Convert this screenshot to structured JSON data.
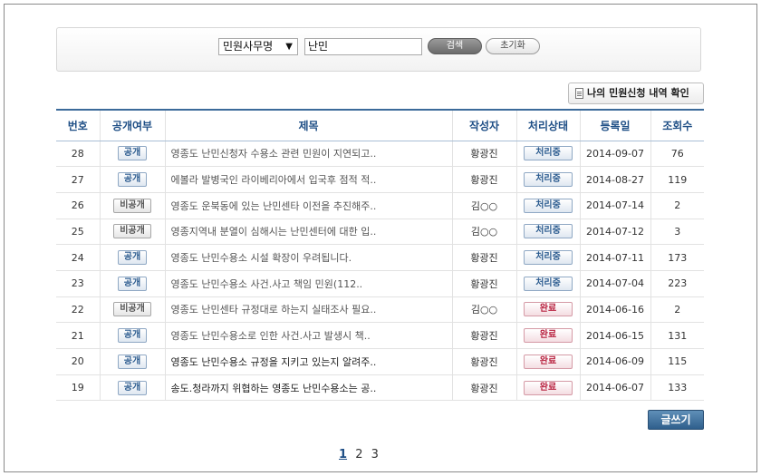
{
  "search": {
    "field_selected": "민원사무명",
    "keyword_value": "난민",
    "search_label": "검색",
    "reset_label": "초기화"
  },
  "my_requests_label": "나의 민원신청 내역 확인",
  "table": {
    "headers": [
      "번호",
      "공개여부",
      "제목",
      "작성자",
      "처리상태",
      "등록일",
      "조회수"
    ],
    "rows": [
      {
        "no": "28",
        "open": "공개",
        "title": "영종도 난민신청자 수용소 관련 민원이 지연되고..",
        "author": "황광진",
        "status": "처리중",
        "date": "2014-09-07",
        "views": "76"
      },
      {
        "no": "27",
        "open": "공개",
        "title": "에볼라 발병국인 라이베리아에서 입국후 점적 적..",
        "author": "황광진",
        "status": "처리중",
        "date": "2014-08-27",
        "views": "119"
      },
      {
        "no": "26",
        "open": "비공개",
        "title": "영종도 운북동에 있는 난민센타 이전을 추진해주..",
        "author": "김○○",
        "status": "처리중",
        "date": "2014-07-14",
        "views": "2"
      },
      {
        "no": "25",
        "open": "비공개",
        "title": "영종지역내 분열이 심해시는 난민센터에 대한 입..",
        "author": "김○○",
        "status": "처리중",
        "date": "2014-07-12",
        "views": "3"
      },
      {
        "no": "24",
        "open": "공개",
        "title": "영종도 난민수용소 시설 확장이 우려됩니다.",
        "author": "황광진",
        "status": "처리중",
        "date": "2014-07-11",
        "views": "173"
      },
      {
        "no": "23",
        "open": "공개",
        "title": "영종도 난민수용소 사건.사고 책임 민원(112..",
        "author": "황광진",
        "status": "처리중",
        "date": "2014-07-04",
        "views": "223"
      },
      {
        "no": "22",
        "open": "비공개",
        "title": "영종도 난민센타 규정대로 하는지 실태조사 필요..",
        "author": "김○○",
        "status": "완료",
        "date": "2014-06-16",
        "views": "2"
      },
      {
        "no": "21",
        "open": "공개",
        "title": "영종도 난민수용소로 인한 사건.사고 발생시 책..",
        "author": "황광진",
        "status": "완료",
        "date": "2014-06-15",
        "views": "131"
      },
      {
        "no": "20",
        "open": "공개",
        "title": "영종도 난민수용소 규정을 지키고 있는지 알려주..",
        "author": "황광진",
        "status": "완료",
        "date": "2014-06-09",
        "views": "115"
      },
      {
        "no": "19",
        "open": "공개",
        "title": "송도.청라까지 위협하는 영종도 난민수용소는 공..",
        "author": "황광진",
        "status": "완료",
        "date": "2014-06-07",
        "views": "133"
      }
    ]
  },
  "write_label": "글쓰기",
  "pagination": [
    "1",
    "2",
    "3"
  ],
  "pagination_current": "1"
}
